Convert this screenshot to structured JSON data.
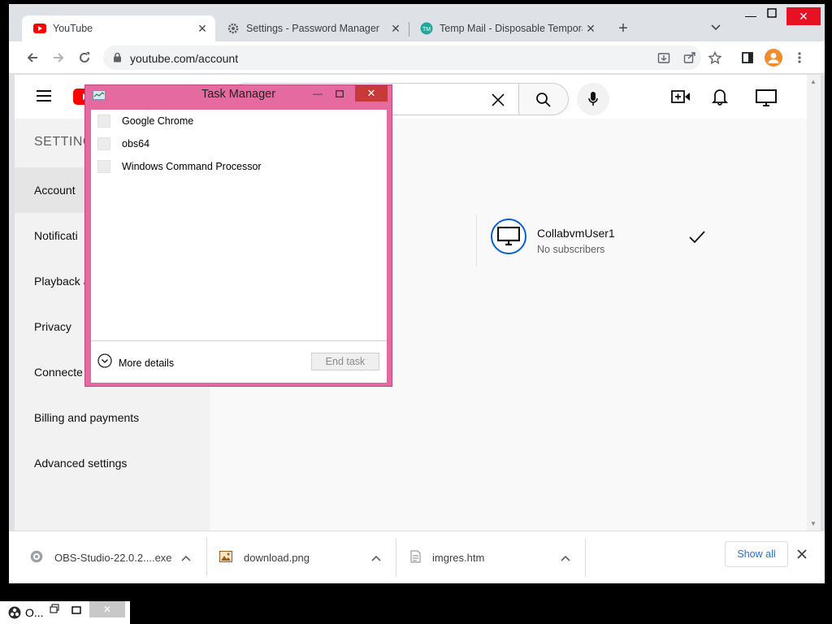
{
  "browser": {
    "tabs": [
      {
        "title": "YouTube",
        "icon": "youtube-icon",
        "active": true
      },
      {
        "title": "Settings - Password Manager",
        "icon": "gear-icon",
        "active": false
      },
      {
        "title": "Temp Mail - Disposable Tempora",
        "icon": "tempmail-icon",
        "active": false
      }
    ],
    "url": "youtube.com/account"
  },
  "youtube": {
    "settings_heading": "SETTING",
    "sidebar": [
      {
        "label": "Account",
        "active": true
      },
      {
        "label": "Notificati",
        "active": false
      },
      {
        "label": "Playback a",
        "active": false
      },
      {
        "label": "Privacy",
        "active": false
      },
      {
        "label": "Connecte",
        "active": false
      },
      {
        "label": "Billing and payments",
        "active": false
      },
      {
        "label": "Advanced settings",
        "active": false
      }
    ],
    "channel": {
      "name": "CollabvmUser1",
      "subscribers": "No subscribers"
    }
  },
  "downloads": {
    "items": [
      {
        "name": "OBS-Studio-22.0.2....exe",
        "icon": "obs-file-icon"
      },
      {
        "name": "download.png",
        "icon": "image-file-icon"
      },
      {
        "name": "imgres.htm",
        "icon": "document-file-icon"
      }
    ],
    "show_all": "Show all"
  },
  "task_manager": {
    "title": "Task Manager",
    "processes": [
      "Google Chrome",
      "obs64",
      "Windows Command Processor"
    ],
    "more_details": "More details",
    "end_task": "End task"
  },
  "taskbar": {
    "item_label": "O..."
  }
}
